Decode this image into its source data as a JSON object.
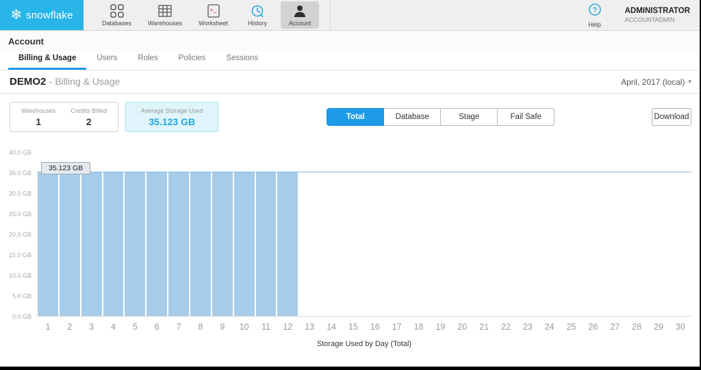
{
  "brand": {
    "name": "snowflake",
    "color": "#29b5e8"
  },
  "nav": {
    "items": [
      {
        "label": "Databases",
        "icon": "databases-icon"
      },
      {
        "label": "Warehouses",
        "icon": "warehouses-icon"
      },
      {
        "label": "Worksheet",
        "icon": "worksheet-icon"
      },
      {
        "label": "History",
        "icon": "history-icon"
      },
      {
        "label": "Account",
        "icon": "account-icon",
        "active": true
      }
    ],
    "help_label": "Help",
    "user": {
      "name": "ADMINISTRATOR",
      "role": "ACCOUNTADMIN"
    }
  },
  "page": {
    "section_title": "Account",
    "tabs": [
      {
        "label": "Billing & Usage",
        "active": true
      },
      {
        "label": "Users"
      },
      {
        "label": "Roles"
      },
      {
        "label": "Policies"
      },
      {
        "label": "Sessions"
      }
    ],
    "title": "DEMO2",
    "subtitle": "- Billing & Usage",
    "date_selector": "April, 2017 (local)"
  },
  "stats": {
    "warehouses_label": "Warehouses",
    "warehouses_value": "1",
    "credits_label": "Credits Billed",
    "credits_value": "2",
    "storage_label": "Average Storage Used",
    "storage_value": "35.123 GB"
  },
  "controls": {
    "segments": [
      {
        "label": "Total",
        "active": true
      },
      {
        "label": "Database"
      },
      {
        "label": "Stage"
      },
      {
        "label": "Fail Safe"
      }
    ],
    "download_label": "Download"
  },
  "chart_data": {
    "type": "bar",
    "title": "",
    "xlabel": "Storage Used by Day (Total)",
    "ylabel": "",
    "ylim": [
      0,
      40
    ],
    "y_ticks": [
      "40.0 GB",
      "35.0 GB",
      "30.0 GB",
      "25.0 GB",
      "20.0 GB",
      "15.0 GB",
      "10.0 GB",
      "5.0 GB",
      "0.0 GB"
    ],
    "categories": [
      1,
      2,
      3,
      4,
      5,
      6,
      7,
      8,
      9,
      10,
      11,
      12,
      13,
      14,
      15,
      16,
      17,
      18,
      19,
      20,
      21,
      22,
      23,
      24,
      25,
      26,
      27,
      28,
      29,
      30
    ],
    "values": [
      35.123,
      35.123,
      35.123,
      35.123,
      35.123,
      35.123,
      35.123,
      35.123,
      35.123,
      35.123,
      35.123,
      35.123,
      0,
      0,
      0,
      0,
      0,
      0,
      0,
      0,
      0,
      0,
      0,
      0,
      0,
      0,
      0,
      0,
      0,
      0
    ],
    "reference_line": 35.123,
    "tooltip": "35.123 GB",
    "bar_color": "#a7cce9",
    "grid": false,
    "legend": null
  }
}
